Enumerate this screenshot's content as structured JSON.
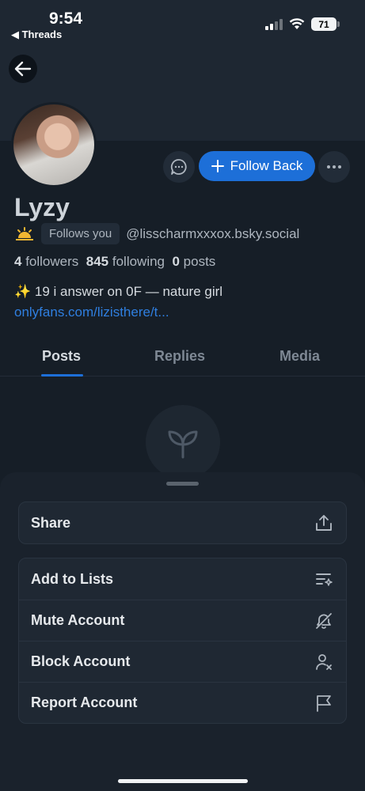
{
  "status_bar": {
    "time": "9:54",
    "back_app": "◀ Threads",
    "battery": "71"
  },
  "profile": {
    "name": "Lyzy",
    "follows_you": "Follows you",
    "handle": "@lisscharmxxxox.bsky.social",
    "followers_count": "4",
    "followers_label": "followers",
    "following_count": "845",
    "following_label": "following",
    "posts_count": "0",
    "posts_label": "posts",
    "bio": "✨ 19 i answer on 0F — nature girl",
    "link": "onlyfans.com/lizisthere/t..."
  },
  "actions": {
    "follow_back": "Follow Back"
  },
  "tabs": [
    {
      "label": "Posts",
      "active": true
    },
    {
      "label": "Replies",
      "active": false
    },
    {
      "label": "Media",
      "active": false
    }
  ],
  "sheet": {
    "share": {
      "label": "Share",
      "icon": "share-icon"
    },
    "items": [
      {
        "label": "Add to Lists",
        "icon": "list-add-icon"
      },
      {
        "label": "Mute Account",
        "icon": "mute-icon"
      },
      {
        "label": "Block Account",
        "icon": "block-user-icon"
      },
      {
        "label": "Report Account",
        "icon": "flag-icon"
      }
    ]
  },
  "colors": {
    "accent": "#1d6fd8",
    "background": "#161e27",
    "sheet": "#1a222c"
  }
}
